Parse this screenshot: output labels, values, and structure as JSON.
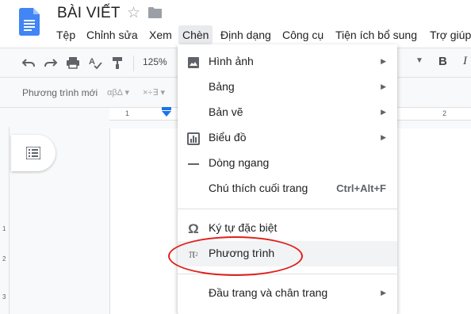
{
  "header": {
    "title": "BÀI VIẾT",
    "menu": [
      "Tệp",
      "Chỉnh sửa",
      "Xem",
      "Chèn",
      "Định dạng",
      "Công cụ",
      "Tiện ích bổ sung",
      "Trợ giúp"
    ],
    "active_menu": "Chèn"
  },
  "toolbar": {
    "zoom": "125%",
    "bold_label": "B",
    "italic_label": "I"
  },
  "equation_bar": {
    "new_equation": "Phương trình mới",
    "greek": "αβΔ ▾",
    "ops": "×÷∃ ▾"
  },
  "ruler": {
    "h_numbers": [
      "1",
      "1",
      "2"
    ],
    "v_numbers": [
      "1",
      "2",
      "3"
    ]
  },
  "insert_menu": {
    "items": [
      {
        "label": "Hình ảnh",
        "icon": "image-icon",
        "has_submenu": true
      },
      {
        "label": "Bảng",
        "icon": "",
        "has_submenu": true
      },
      {
        "label": "Bản vẽ",
        "icon": "",
        "has_submenu": true
      },
      {
        "label": "Biểu đồ",
        "icon": "chart-icon",
        "has_submenu": true
      },
      {
        "label": "Dòng ngang",
        "icon": "horizontal-line-icon",
        "has_submenu": false
      },
      {
        "label": "Chú thích cuối trang",
        "icon": "",
        "shortcut": "Ctrl+Alt+F"
      },
      {
        "label": "Ký tự đặc biệt",
        "icon": "omega-icon",
        "has_submenu": false
      },
      {
        "label": "Phương trình",
        "icon": "pi-icon",
        "has_submenu": false,
        "highlighted": true
      },
      {
        "label": "Đầu trang và chân trang",
        "icon": "",
        "has_submenu": true
      }
    ]
  },
  "colors": {
    "accent": "#1a73e8",
    "annotation": "#e0201b",
    "doc_icon": "#4285f4"
  }
}
